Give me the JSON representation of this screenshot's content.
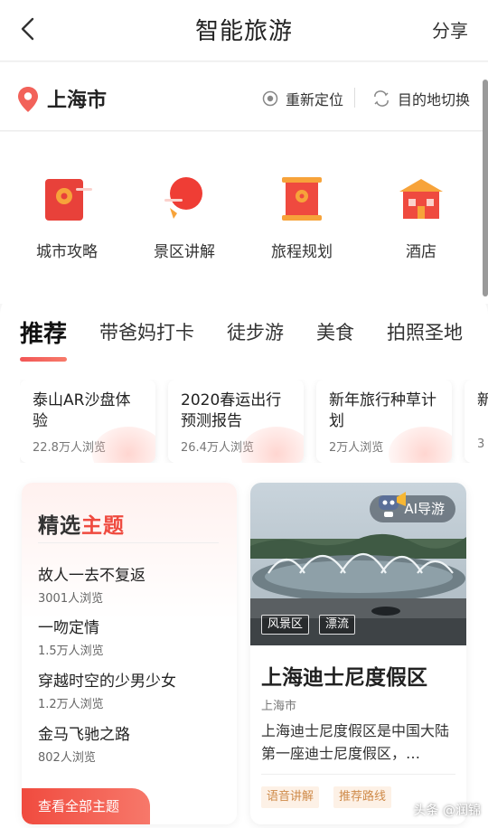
{
  "header": {
    "title": "智能旅游",
    "share": "分享"
  },
  "location": {
    "city": "上海市",
    "relocate": "重新定位",
    "switch": "目的地切换"
  },
  "services": [
    {
      "label": "城市攻略",
      "icon": "city-guide-icon"
    },
    {
      "label": "景区讲解",
      "icon": "scenic-explain-icon"
    },
    {
      "label": "旅程规划",
      "icon": "trip-plan-icon"
    },
    {
      "label": "酒店",
      "icon": "hotel-icon"
    }
  ],
  "tabs": [
    "推荐",
    "带爸妈打卡",
    "徒步游",
    "美食",
    "拍照圣地"
  ],
  "cards": [
    {
      "title": "泰山AR沙盘体验",
      "views": "22.8万人浏览"
    },
    {
      "title": "2020春运出行预测报告",
      "views": "26.4万人浏览"
    },
    {
      "title": "新年旅行种草计划",
      "views": "2万人浏览"
    },
    {
      "title": "新",
      "views": "3"
    }
  ],
  "theme": {
    "title_a": "精选",
    "title_b": "主题",
    "items": [
      {
        "name": "故人一去不复返",
        "views": "3001人浏览"
      },
      {
        "name": "一吻定情",
        "views": "1.5万人浏览"
      },
      {
        "name": "穿越时空的少男少女",
        "views": "1.2万人浏览"
      },
      {
        "name": "金马飞驰之路",
        "views": "802人浏览"
      }
    ],
    "all_button": "查看全部主题"
  },
  "poi": {
    "badge": "AI导游",
    "image_tags": [
      "风景区",
      "漂流"
    ],
    "name": "上海迪士尼度假区",
    "city": "上海市",
    "desc": "上海迪士尼度假区是中国大陆第一座迪士尼度假区，…",
    "tags": [
      "语音讲解",
      "推荐路线"
    ]
  },
  "watermark": "头条 @润锦",
  "colors": {
    "accent": "#ef4a3f",
    "tag_bg": "#fdf1e6",
    "tag_text": "#cf8b4a"
  }
}
